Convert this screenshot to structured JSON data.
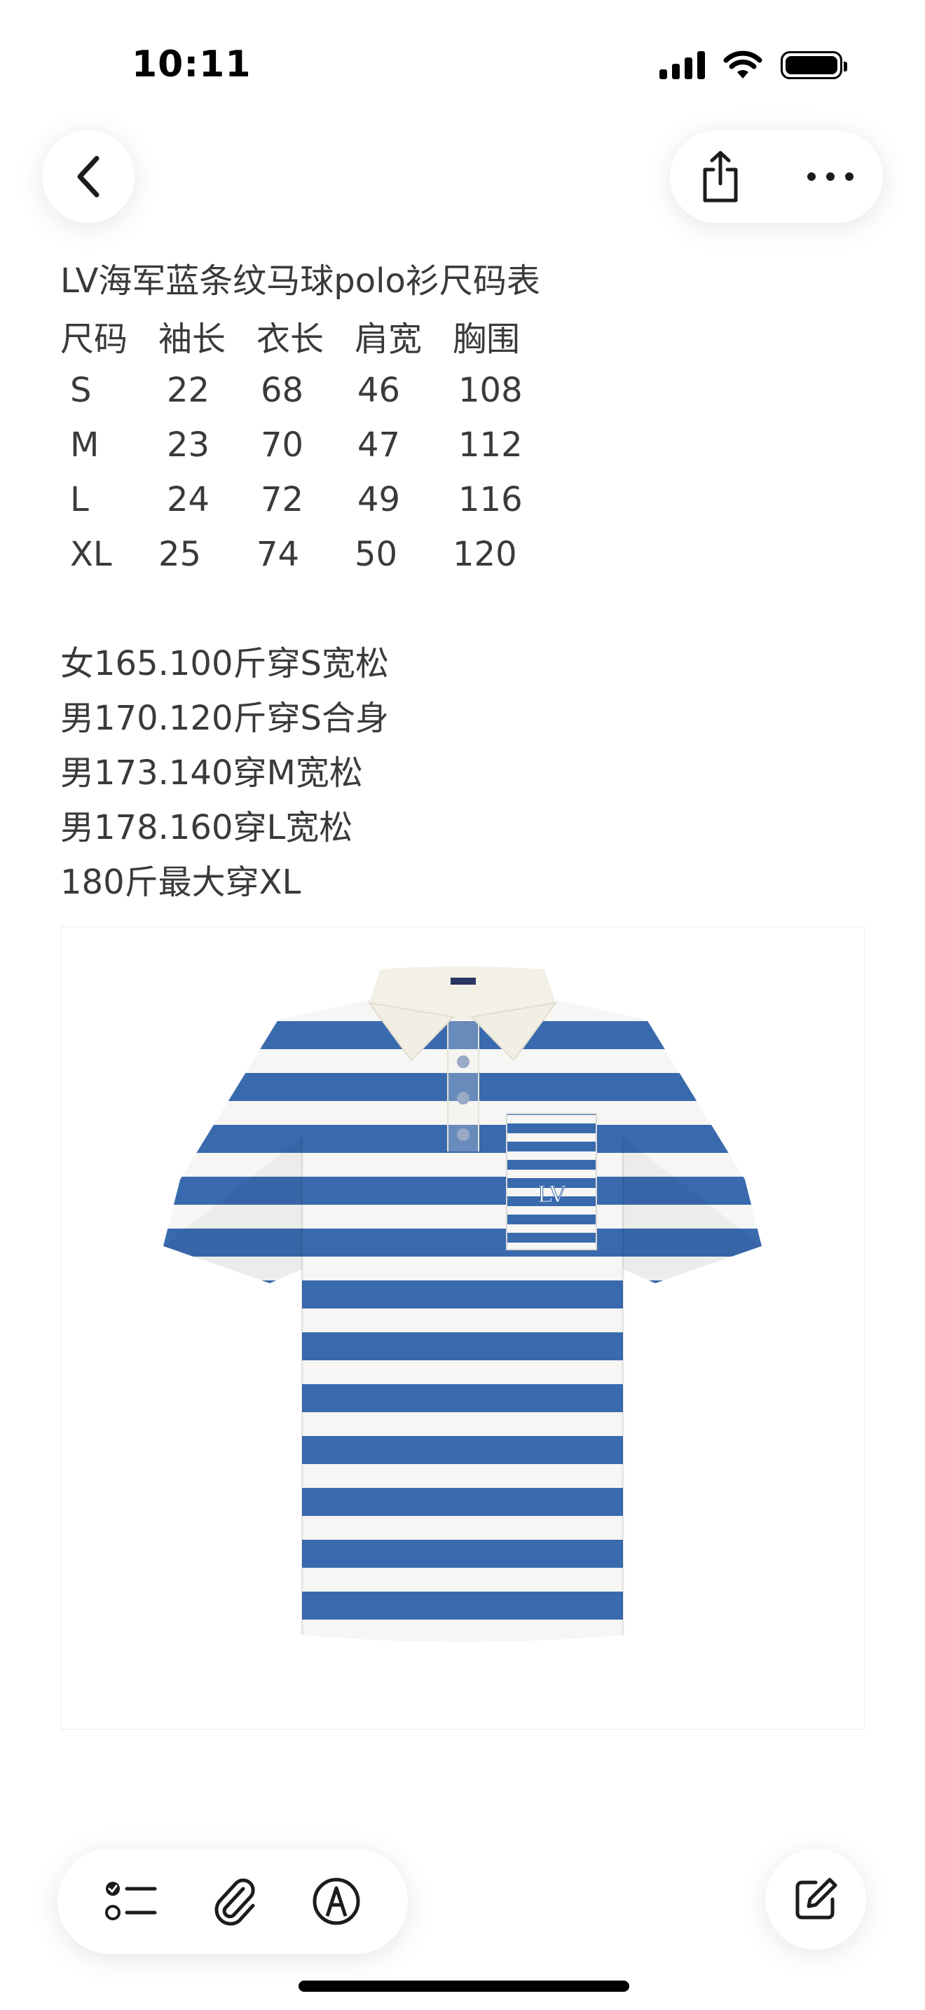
{
  "status_bar": {
    "time": "10:11",
    "signal_icon": "cellular-signal-icon",
    "wifi_icon": "wifi-icon",
    "battery_icon": "battery-icon"
  },
  "nav": {
    "back_icon": "chevron-left-icon",
    "share_icon": "share-icon",
    "more_icon": "ellipsis-icon"
  },
  "note": {
    "title": "LV海军蓝条纹马球polo衫尺码表",
    "table": {
      "headers": [
        "尺码",
        "袖长",
        "衣长",
        "肩宽",
        "胸围"
      ],
      "rows": [
        [
          "S",
          "22",
          "68",
          "46",
          "108"
        ],
        [
          "M",
          "23",
          "70",
          "47",
          "112"
        ],
        [
          "L",
          "24",
          "72",
          "49",
          "116"
        ],
        [
          "XL",
          "25",
          "74",
          "50",
          "120"
        ]
      ]
    },
    "fit_notes": [
      "女165.100斤穿S宽松",
      "男170.120斤穿S合身",
      "男173.140穿M宽松",
      "男178.160穿L宽松",
      "180斤最大穿XL"
    ],
    "image_subject": "blue-white-striped-polo-shirt"
  },
  "toolbar": {
    "checklist_icon": "checklist-icon",
    "attachment_icon": "paperclip-icon",
    "markup_icon": "markup-pen-icon",
    "compose_icon": "compose-icon"
  },
  "colors": {
    "stripe_blue": "#3a6aae",
    "stripe_white": "#f6f6f4",
    "collar": "#f3f0e6",
    "text": "#3a3a3c"
  }
}
